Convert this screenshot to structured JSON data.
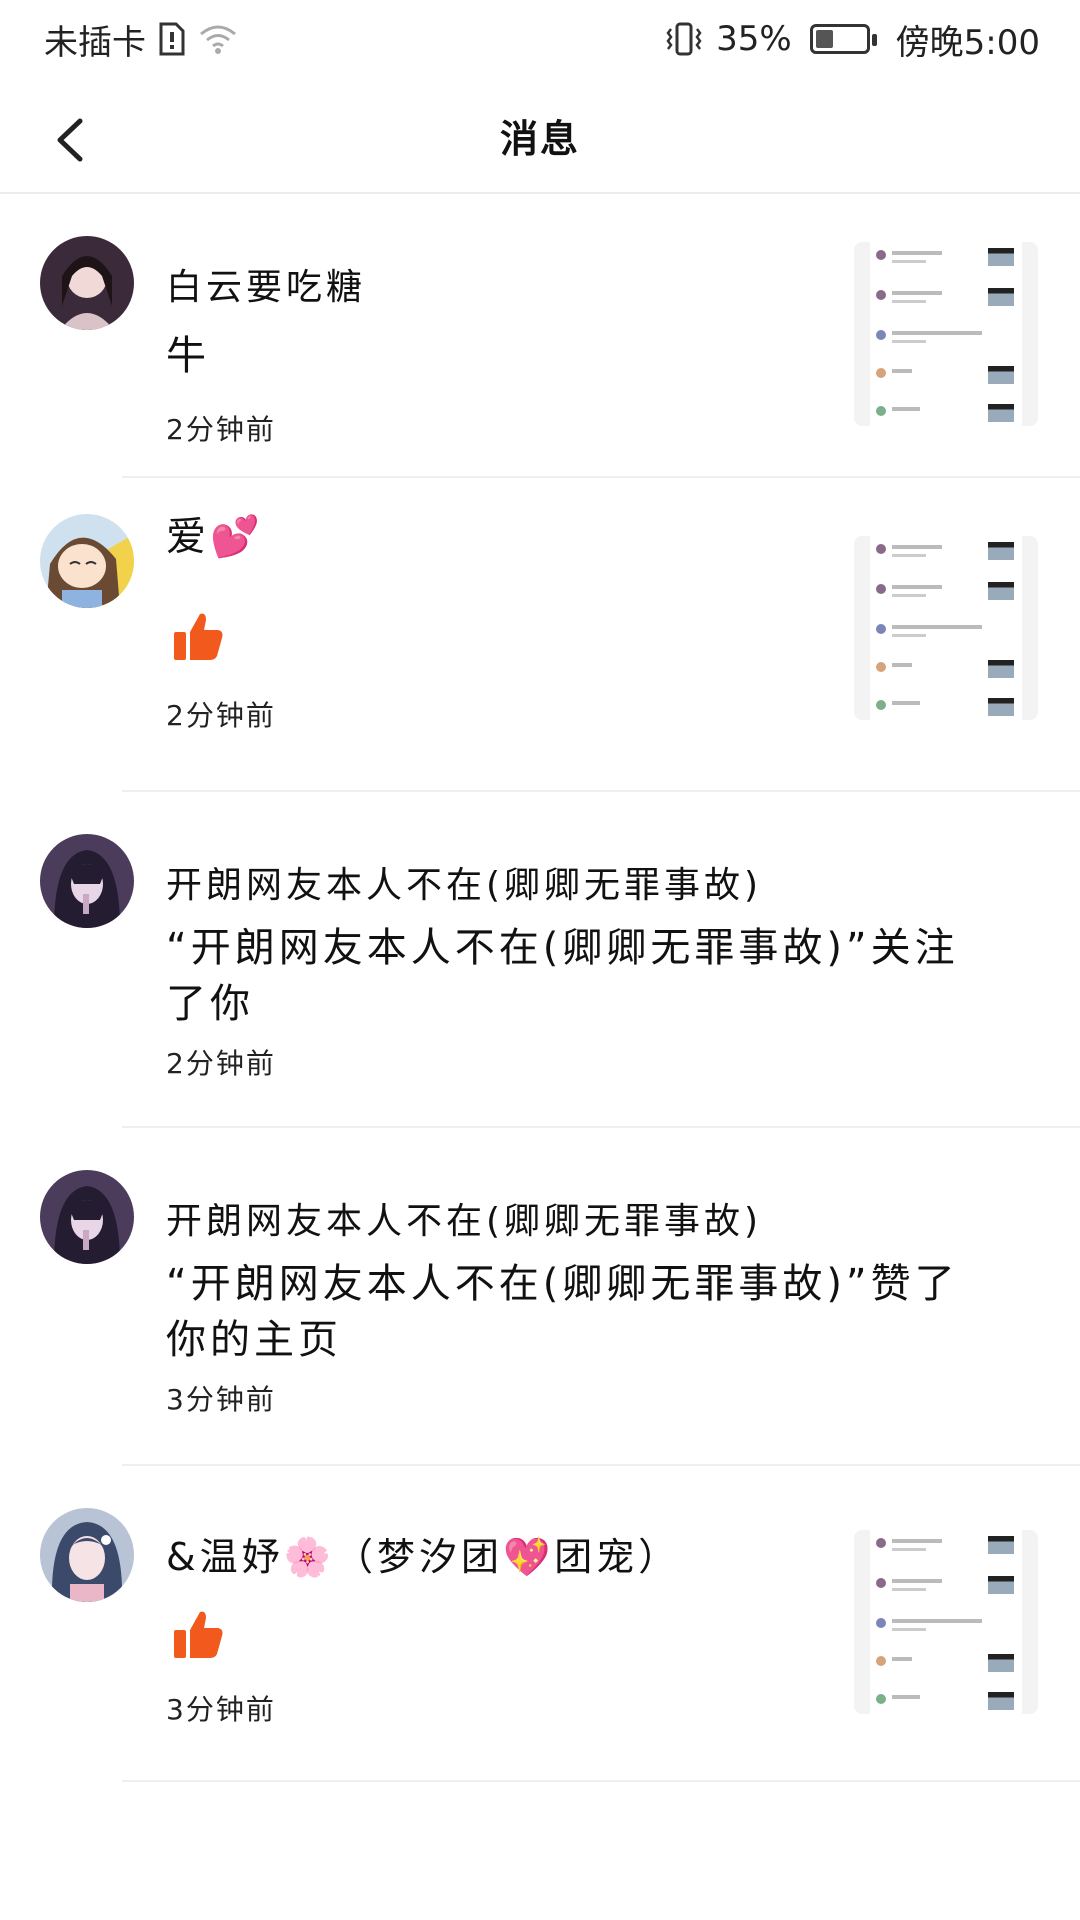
{
  "status_bar": {
    "carrier": "未插卡",
    "battery_percent": "35%",
    "battery_level": 0.35,
    "time": "傍晚5:00"
  },
  "header": {
    "title": "消息"
  },
  "messages": [
    {
      "name": "白云要吃糖",
      "text": "牛",
      "time": "2分钟前"
    },
    {
      "name": "爱💕",
      "text": "",
      "time": "2分钟前"
    },
    {
      "name": "开朗网友本人不在(卿卿无罪事故)",
      "text": "“开朗网友本人不在(卿卿无罪事故)”关注了你",
      "time": "2分钟前"
    },
    {
      "name": "开朗网友本人不在(卿卿无罪事故)",
      "text": "“开朗网友本人不在(卿卿无罪事故)”赞了你的主页",
      "time": "3分钟前"
    },
    {
      "name": "&温妤🌸（梦汐团💖团宠）",
      "text": "",
      "time": "3分钟前"
    }
  ],
  "icons": {
    "back": "chevron-left-icon",
    "like": "thumbs-up-icon",
    "sim": "sim-card-icon",
    "wifi": "wifi-icon",
    "vibrate": "vibrate-icon",
    "battery": "battery-icon"
  },
  "colors": {
    "like_orange": "#f25a1d",
    "divider": "#efefef"
  }
}
